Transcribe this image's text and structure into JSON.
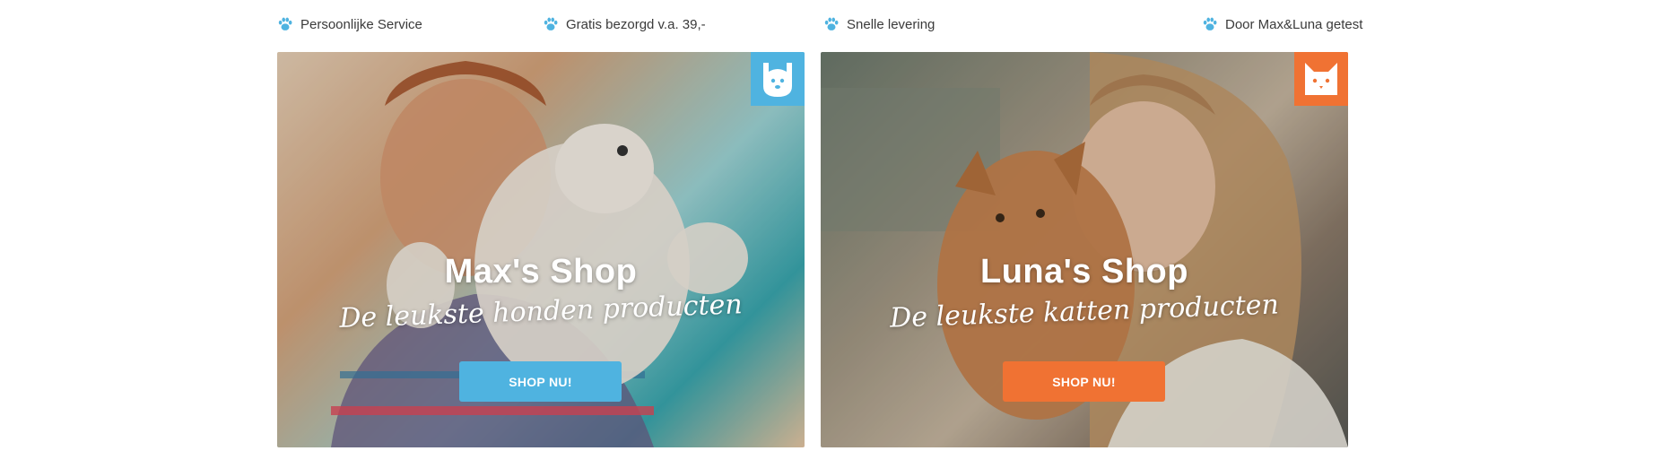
{
  "usps": [
    {
      "label": "Persoonlijke Service",
      "icon": "paw-icon"
    },
    {
      "label": "Gratis bezorgd v.a. 39,-",
      "icon": "paw-icon"
    },
    {
      "label": "Snelle levering",
      "icon": "paw-icon"
    },
    {
      "label": "Door Max&Luna getest",
      "icon": "paw-icon"
    }
  ],
  "cards": {
    "max": {
      "title": "Max's Shop",
      "subtitle": "De leukste honden producten",
      "button": "SHOP NU!",
      "badge_icon": "dog-icon",
      "accent": "#4fb3e0"
    },
    "luna": {
      "title": "Luna's Shop",
      "subtitle": "De leukste katten producten",
      "button": "SHOP NU!",
      "badge_icon": "cat-icon",
      "accent": "#f07233"
    }
  },
  "colors": {
    "paw": "#4fb3e0",
    "text": "#3a3a3a"
  }
}
